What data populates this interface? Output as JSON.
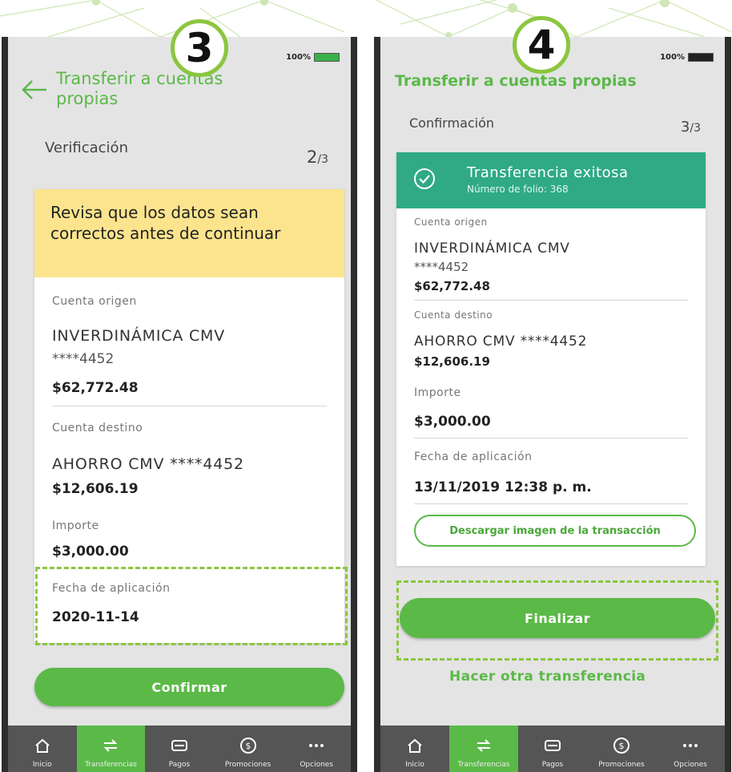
{
  "screen3": {
    "step_badge": "3",
    "battery": "100%",
    "title_line1": "Transferir a cuentas",
    "title_line2": "propias",
    "step_label": "Verificación",
    "step_num": "2",
    "step_total": "/3",
    "warning": "Revisa que los datos sean correctos antes de continuar",
    "origin_label": "Cuenta origen",
    "origin_name": "INVERDINÁMICA CMV",
    "origin_number": "****4452",
    "origin_amount": "$62,772.48",
    "dest_label": "Cuenta destino",
    "dest_name": "AHORRO CMV ****4452",
    "dest_amount": "$12,606.19",
    "amount_label": "Importe",
    "amount_value": "$3,000.00",
    "date_label": "Fecha de aplicación",
    "date_value": "2020-11-14",
    "confirm_label": "Confirmar"
  },
  "screen4": {
    "step_badge": "4",
    "battery": "100%",
    "title": "Transferir a cuentas propias",
    "step_label": "Confirmación",
    "step_num": "3",
    "step_total": "/3",
    "success_title": "Transferencia exitosa",
    "folio": "Número de folio: 368",
    "origin_label": "Cuenta origen",
    "origin_name": "INVERDINÁMICA CMV",
    "origin_number": "****4452",
    "origin_amount": "$62,772.48",
    "dest_label": "Cuenta destino",
    "dest_name": "AHORRO CMV ****4452",
    "dest_amount": "$12,606.19",
    "amount_label": "Importe",
    "amount_value": "$3,000.00",
    "date_label": "Fecha de aplicación",
    "date_value": "13/11/2019 12:38 p. m.",
    "download_label": "Descargar imagen de la transacción",
    "finish_label": "Finalizar",
    "another_label": "Hacer otra transferencia"
  },
  "tabs": [
    {
      "label": "Inicio",
      "icon": "home-icon"
    },
    {
      "label": "Transferencias",
      "icon": "transfer-icon"
    },
    {
      "label": "Pagos",
      "icon": "card-icon"
    },
    {
      "label": "Promociones",
      "icon": "dollar-coin-icon"
    },
    {
      "label": "Opciones",
      "icon": "more-icon"
    }
  ],
  "colors": {
    "accent": "#5bb948",
    "warning_bg": "#fbe48d",
    "success_header": "#2faa84",
    "tabbar": "#555555"
  }
}
